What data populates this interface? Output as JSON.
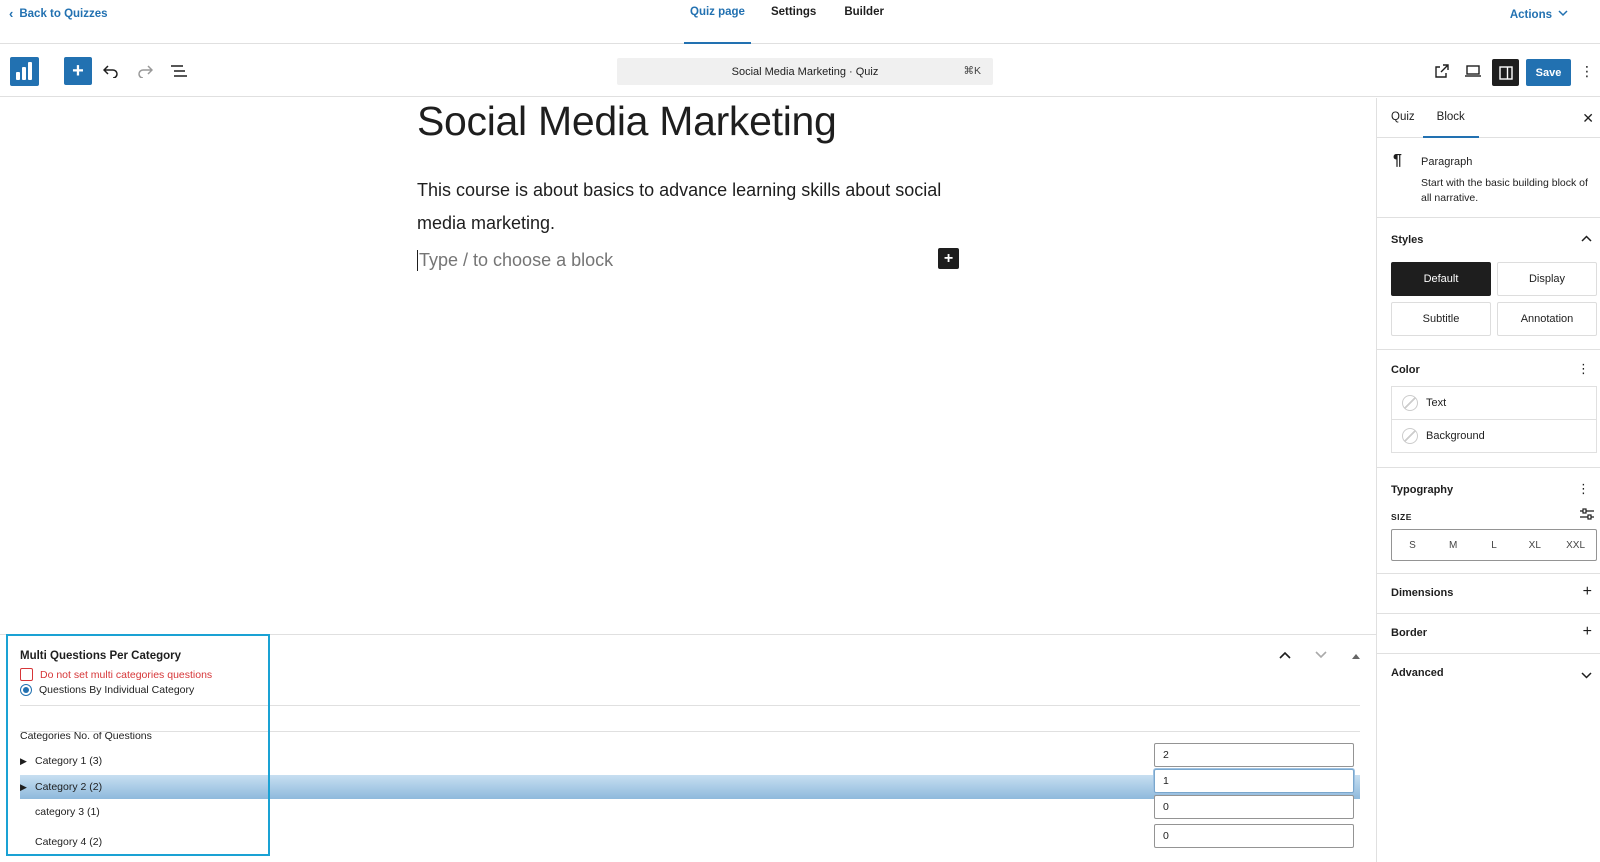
{
  "topnav": {
    "back_label": "Back to Quizzes",
    "tabs": [
      {
        "label": "Quiz page",
        "active": true
      },
      {
        "label": "Settings",
        "active": false
      },
      {
        "label": "Builder",
        "active": false
      }
    ],
    "actions_label": "Actions"
  },
  "toolbar": {
    "command_title": "Social Media Marketing · Quiz",
    "command_shortcut": "⌘K",
    "save_label": "Save",
    "accent_color": "#2271b1"
  },
  "canvas": {
    "title": "Social Media Marketing",
    "body": "This course is about  basics to advance learning skills about social media marketing.",
    "placeholder": "Type / to choose a block"
  },
  "sidebar": {
    "tabs": [
      {
        "label": "Quiz",
        "active": false
      },
      {
        "label": "Block",
        "active": true
      }
    ],
    "block": {
      "name": "Paragraph",
      "description": "Start with the basic building block of all narrative."
    },
    "styles": {
      "title": "Styles",
      "options": [
        {
          "label": "Default",
          "active": true
        },
        {
          "label": "Display",
          "active": false
        },
        {
          "label": "Subtitle",
          "active": false
        },
        {
          "label": "Annotation",
          "active": false
        }
      ]
    },
    "color": {
      "title": "Color",
      "items": [
        "Text",
        "Background"
      ]
    },
    "typography": {
      "title": "Typography",
      "size_label": "SIZE",
      "sizes": [
        "S",
        "M",
        "L",
        "XL",
        "XXL"
      ]
    },
    "dimensions_title": "Dimensions",
    "border_title": "Border",
    "advanced_title": "Advanced"
  },
  "meta": {
    "title": "Multi Questions Per Category",
    "checkbox_label": "Do not set multi categories questions",
    "radio_label": "Questions By Individual Category",
    "table_header": "Categories No. of Questions",
    "categories": [
      {
        "label": "Category 1 (3)",
        "value": "2",
        "expandable": true,
        "selected": false
      },
      {
        "label": "Category 2 (2)",
        "value": "1",
        "expandable": true,
        "selected": true
      },
      {
        "label": "category 3 (1)",
        "value": "0",
        "expandable": false,
        "selected": false
      },
      {
        "label": "Category 4 (2)",
        "value": "0",
        "expandable": false,
        "selected": false
      }
    ]
  }
}
